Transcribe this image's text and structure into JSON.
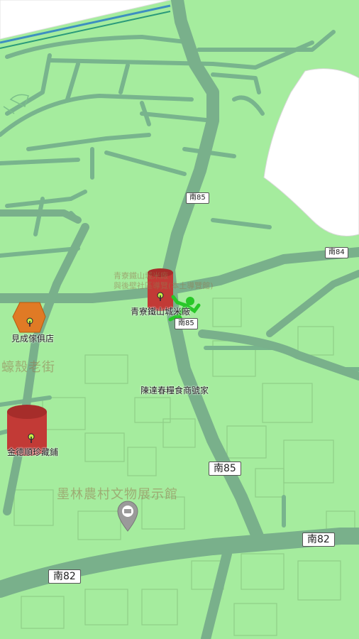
{
  "colors": {
    "land": "#a5ec9e",
    "road": "#78b48d",
    "minor_road": "#86c79a",
    "building_outline": "#93d58c",
    "water_area": "#ffffff",
    "rail": "#3d8fc0",
    "marker_red": "#c23a36",
    "marker_orange": "#e07a25",
    "player_green": "#28c828"
  },
  "route_shields": {
    "nan85_upper": "南85",
    "nan84": "南84",
    "nan85_middle": "南85",
    "nan85_lower": "南85",
    "nan82_right": "南82",
    "nan82_left": "南82"
  },
  "labels": {
    "poi_1": "青寮鐵山城米廠",
    "poi_2": "見成傢俱店",
    "poi_3": "金德順珍藏鋪",
    "poi_4": "陳達春糧食商號家",
    "faded_1": "墨林農村文物展示館",
    "faded_2": "蠔殼老街",
    "faded_3": "青寮鐵山城米廠",
    "faded_4": "與後壁社區導覽(本土導覽館)"
  },
  "icons": {
    "player": "running-person-icon",
    "marker": "location-pin-icon",
    "museum": "museum-pin-icon"
  }
}
